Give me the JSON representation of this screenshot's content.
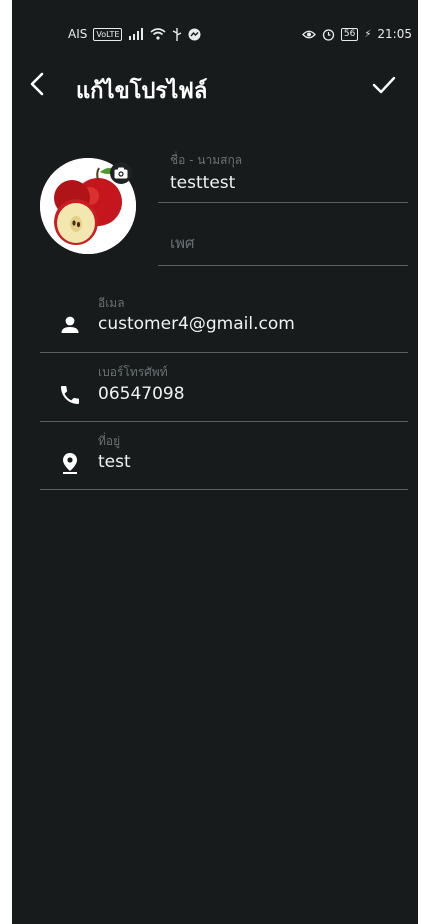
{
  "status_bar": {
    "carrier": "AIS",
    "volte_badge": "VoLTE",
    "battery": "56",
    "time": "21:05"
  },
  "header": {
    "title": "แก้ไขโปรไฟล์"
  },
  "profile": {
    "name_label": "ชื่อ - นามสกุล",
    "name_value": "testtest",
    "gender_placeholder": "เพศ"
  },
  "fields": {
    "email": {
      "label": "อีเมล",
      "value": "customer4@gmail.com",
      "icon": "person-icon"
    },
    "phone": {
      "label": "เบอร์โทรศัพท์",
      "value": "06547098",
      "icon": "phone-icon"
    },
    "address": {
      "label": "ที่อยู่",
      "value": "test",
      "icon": "location-pin-icon"
    }
  },
  "colors": {
    "background": "#171b1c",
    "label": "#6a7173",
    "text": "#f1f3f3",
    "divider": "#5b6163"
  }
}
